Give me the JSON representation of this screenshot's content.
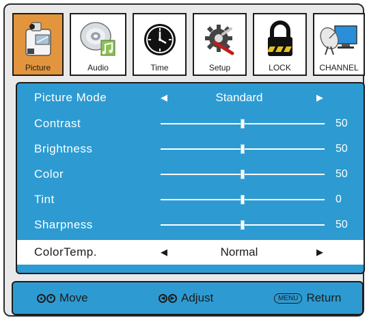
{
  "tabs": [
    {
      "label": "Picture",
      "icon": "projector-icon",
      "active": true
    },
    {
      "label": "Audio",
      "icon": "disc-music-icon",
      "active": false
    },
    {
      "label": "Time",
      "icon": "clock-icon",
      "active": false
    },
    {
      "label": "Setup",
      "icon": "gear-tools-icon",
      "active": false
    },
    {
      "label": "LOCK",
      "icon": "padlock-icon",
      "active": false
    },
    {
      "label": "CHANNEL",
      "icon": "satellite-dish-icon",
      "active": false
    }
  ],
  "menu": {
    "picture_mode": {
      "label": "Picture Mode",
      "value": "Standard"
    },
    "sliders": [
      {
        "label": "Contrast",
        "value": "50",
        "level": 0.5
      },
      {
        "label": "Brightness",
        "value": "50",
        "level": 0.5
      },
      {
        "label": "Color",
        "value": "50",
        "level": 0.5
      },
      {
        "label": "Tint",
        "value": "0",
        "level": 0.5
      },
      {
        "label": "Sharpness",
        "value": "50",
        "level": 0.5
      }
    ],
    "color_temp": {
      "label": "ColorTemp.",
      "value": "Normal"
    }
  },
  "footer": {
    "move": "Move",
    "adjust": "Adjust",
    "menu_key": "MENU",
    "return": "Return"
  },
  "colors": {
    "panel": "#2d9bd2",
    "active_tab": "#e3953e",
    "frame": "#e9e9e9"
  }
}
